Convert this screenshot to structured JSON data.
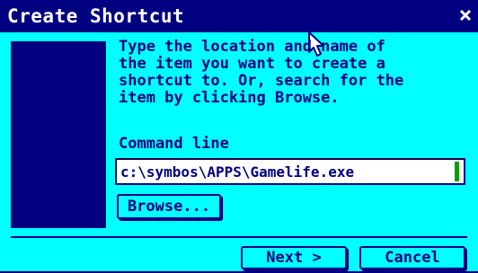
{
  "window": {
    "title": "Create Shortcut",
    "close_icon": "close-icon"
  },
  "description": "Type the location and name of\nthe item you want to create a\nshortcut to. Or, search for the\nitem by clicking Browse.",
  "command": {
    "label": "Command line",
    "value": "c:\\symbos\\APPS\\Gamelife.exe"
  },
  "buttons": {
    "browse": "Browse...",
    "next": "Next >",
    "cancel": "Cancel"
  },
  "colors": {
    "background": "#00ffff",
    "foreground": "#000080",
    "input_background": "#ffffff",
    "caret": "#00a000"
  }
}
